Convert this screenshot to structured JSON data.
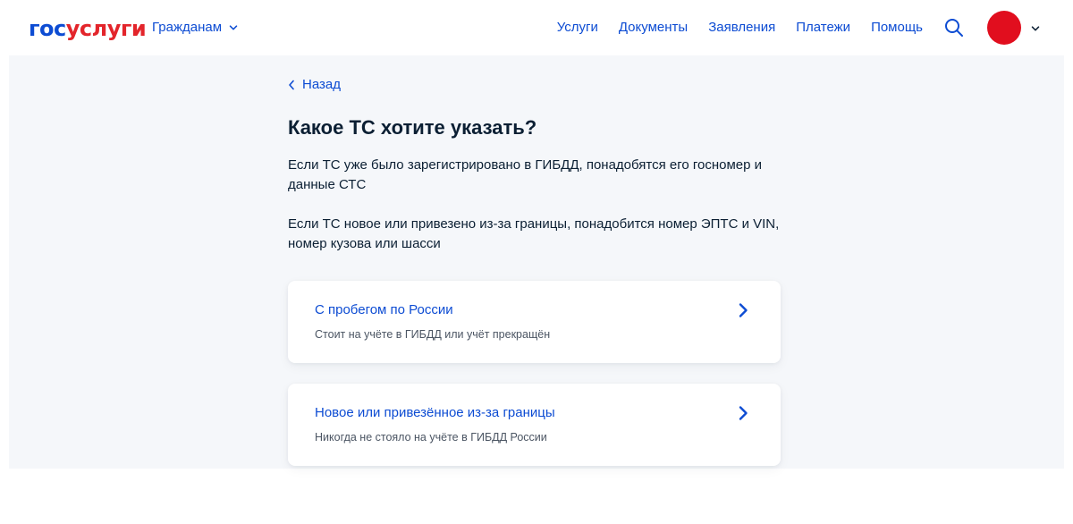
{
  "header": {
    "logo_part1": "гос",
    "logo_part2": "услуги",
    "citizens_label": "Гражданам",
    "nav": [
      {
        "label": "Услуги"
      },
      {
        "label": "Документы"
      },
      {
        "label": "Заявления"
      },
      {
        "label": "Платежи"
      },
      {
        "label": "Помощь"
      }
    ],
    "search_icon": "search-icon",
    "avatar_color": "#e10e1e"
  },
  "main": {
    "back_label": "Назад",
    "title": "Какое ТС хотите указать?",
    "paragraph1": "Если ТС уже было зарегистрировано в ГИБДД, понадобятся его госномер и данные СТС",
    "paragraph2": "Если ТС новое или привезено из-за границы, понадобится номер ЭПТС и VIN, номер кузова или шасси",
    "options": [
      {
        "title": "С пробегом по России",
        "subtitle": "Стоит на учёте в ГИБДД или учёт прекращён"
      },
      {
        "title": "Новое или привезённое из-за границы",
        "subtitle": "Никогда не стояло на учёте в ГИБДД России"
      }
    ]
  },
  "colors": {
    "accent": "#0d4cd3",
    "brand_red": "#e3252b",
    "background": "#f5f7fa"
  }
}
